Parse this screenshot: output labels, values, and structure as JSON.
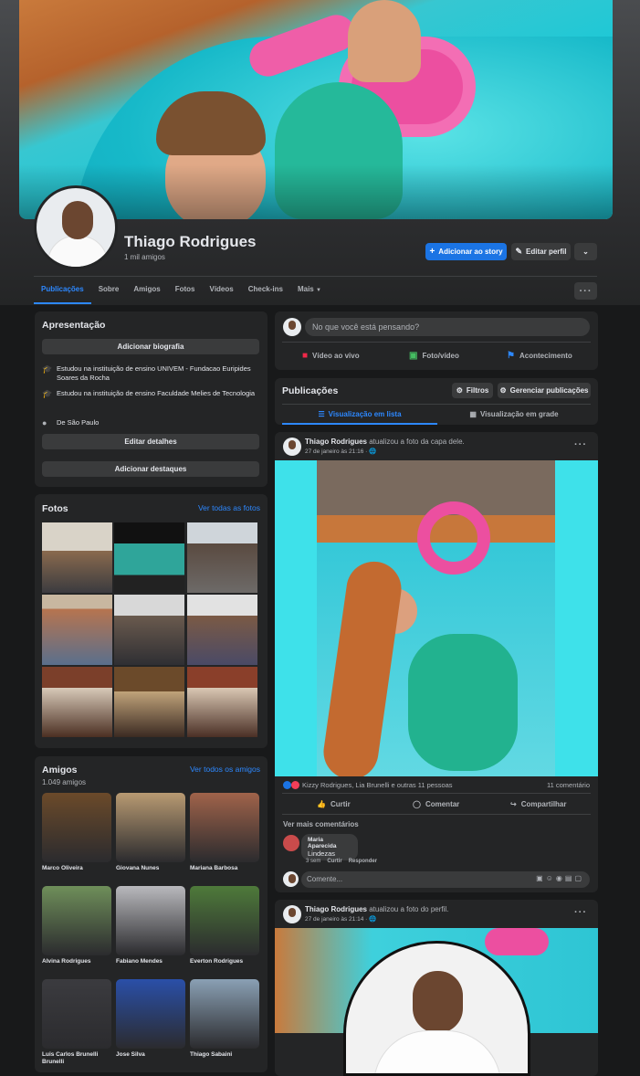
{
  "profile": {
    "name": "Thiago Rodrigues",
    "friends_count": "1 mil amigos"
  },
  "actions": {
    "add_story": "Adicionar ao story",
    "edit_profile": "Editar perfil"
  },
  "tabs": [
    "Publicações",
    "Sobre",
    "Amigos",
    "Fotos",
    "Vídeos",
    "Check-ins",
    "Mais"
  ],
  "intro": {
    "title": "Apresentação",
    "add_bio": "Adicionar biografia",
    "items": [
      "Estudou na instituição de ensino UNIVEM - Fundacao Euripides Soares da Rocha",
      "Estudou na instituição de ensino Faculdade Melies de Tecnologia",
      "De São Paulo"
    ],
    "edit_details": "Editar detalhes",
    "add_highlights": "Adicionar destaques"
  },
  "photos": {
    "title": "Fotos",
    "see_all": "Ver todas as fotos"
  },
  "friends": {
    "title": "Amigos",
    "see_all": "Ver todos os amigos",
    "count": "1.049 amigos",
    "list": [
      {
        "name": "Marco Oliveira",
        "color": "#6b4a2a"
      },
      {
        "name": "Giovana Nunes",
        "color": "#b89a72"
      },
      {
        "name": "Mariana Barbosa",
        "color": "#a0634a"
      },
      {
        "name": "Alvina Rodrigues",
        "color": "#6f8f5a"
      },
      {
        "name": "Fabiano Mendes",
        "color": "#b9b9bd"
      },
      {
        "name": "Everton Rodrigues",
        "color": "#4e7a3a"
      },
      {
        "name": "Luis Carlos Brunelli Brunelli",
        "color": "#3b3b3f"
      },
      {
        "name": "Jose Silva",
        "color": "#2a4fa8"
      },
      {
        "name": "Thiago Sabaini",
        "color": "#8aa0b4"
      }
    ]
  },
  "composer": {
    "placeholder": "No que você está pensando?",
    "live": "Vídeo ao vivo",
    "photo": "Foto/vídeo",
    "event": "Acontecimento"
  },
  "posts_header": {
    "title": "Publicações",
    "filters": "Filtros",
    "manage": "Gerenciar publicações",
    "list_view": "Visualização em lista",
    "grid_view": "Visualização em grade"
  },
  "post1": {
    "author": "Thiago Rodrigues",
    "action": "atualizou a foto da capa dele.",
    "date": "27 de janeiro às 21:16 · ",
    "reactions": "Kizzy Rodrigues, Lia Brunelli e outras 11 pessoas",
    "comments_count": "11 comentário",
    "like": "Curtir",
    "comment": "Comentar",
    "share": "Compartilhar",
    "see_more": "Ver mais comentários",
    "commenter": "Maria Aparecida",
    "comment_text": "Lindezas",
    "comment_time": "3 sem",
    "comment_like": "Curtir",
    "comment_reply": "Responder",
    "comment_placeholder": "Comente..."
  },
  "post2": {
    "author": "Thiago Rodrigues",
    "action": "atualizou a foto do perfil.",
    "date": "27 de janeiro às 21:14 · "
  },
  "colors": {
    "accent": "#2d88ff",
    "primary_button": "#1b74e4",
    "card": "#242526",
    "background": "#18191a"
  }
}
